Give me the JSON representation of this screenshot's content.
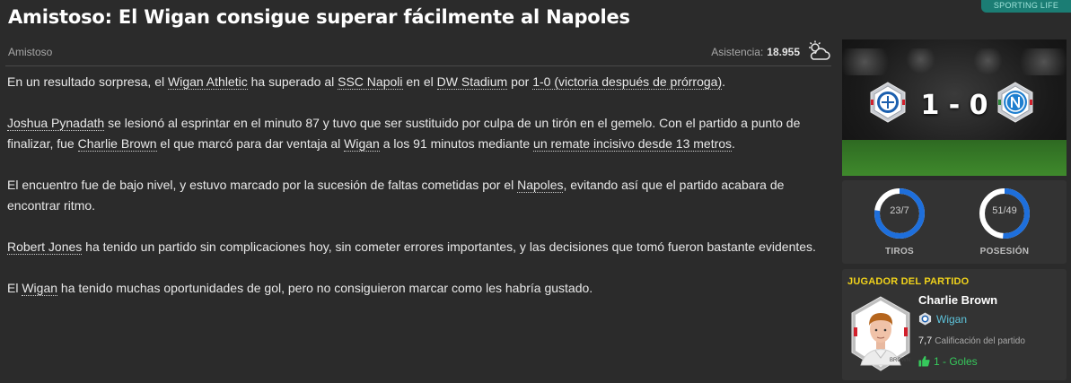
{
  "header": {
    "headline": "Amistoso: El Wigan consigue superar fácilmente al Napoles",
    "section_tag": "SPORTING LIFE"
  },
  "meta": {
    "category": "Amistoso",
    "attendance_label": "Asistencia:",
    "attendance_value": "18.955",
    "weather_icon": "partly-cloudy-icon"
  },
  "article": {
    "p1": {
      "t1": "En un resultado sorpresa, el ",
      "l1": "Wigan Athletic",
      "t2": " ha superado al ",
      "l2": "SSC Napoli",
      "t3": " en el ",
      "l3": "DW Stadium",
      "t4": " por ",
      "l4": "1-0 (victoria después de prórroga)",
      "t5": "."
    },
    "p2": {
      "l1": "Joshua Pynadath",
      "t1": " se lesionó al esprintar en el minuto 87 y tuvo que ser sustituido por culpa de un tirón en el gemelo. Con el partido a punto de finalizar, fue ",
      "l2": "Charlie Brown",
      "t2": " el que marcó para dar ventaja al ",
      "l3": "Wigan",
      "t3": " a los 91 minutos mediante ",
      "l4": "un remate incisivo desde 13 metros",
      "t4": "."
    },
    "p3": {
      "t1": "El encuentro fue de bajo nivel, y estuvo marcado por la sucesión de faltas cometidas por el ",
      "l1": "Napoles",
      "t2": ", evitando así que el partido acabara de encontrar ritmo."
    },
    "p4": {
      "l1": "Robert Jones",
      "t1": " ha tenido un partido sin complicaciones hoy, sin cometer errores importantes, y las decisiones que tomó fueron bastante evidentes."
    },
    "p5": {
      "t1": "El ",
      "l1": "Wigan",
      "t2": " ha tenido muchas oportunidades de gol, pero no consiguieron marcar como les habría gustado."
    }
  },
  "match": {
    "score": "1 - 0",
    "home_crest_icon": "wigan-crest-icon",
    "away_crest_icon": "napoli-crest-icon"
  },
  "stats": {
    "shots_label": "TIROS",
    "shots_value": "23/7",
    "shots_home_fraction": 0.77,
    "possession_label": "POSESIÓN",
    "possession_value": "51/49",
    "possession_home_fraction": 0.51,
    "home_color": "#1e6fdc",
    "away_color": "#ffffff"
  },
  "potm": {
    "title": "JUGADOR DEL PARTIDO",
    "name": "Charlie Brown",
    "club": "Wigan",
    "rating": "7,7",
    "rating_label": "Calificación del partido",
    "goals": "1 - Goles",
    "shirt_name": "BROWN"
  },
  "colors": {
    "background": "#2b2b2b",
    "accent_yellow": "#f0d21b",
    "link_cyan": "#5ec4dc",
    "goal_green": "#36c95c"
  }
}
